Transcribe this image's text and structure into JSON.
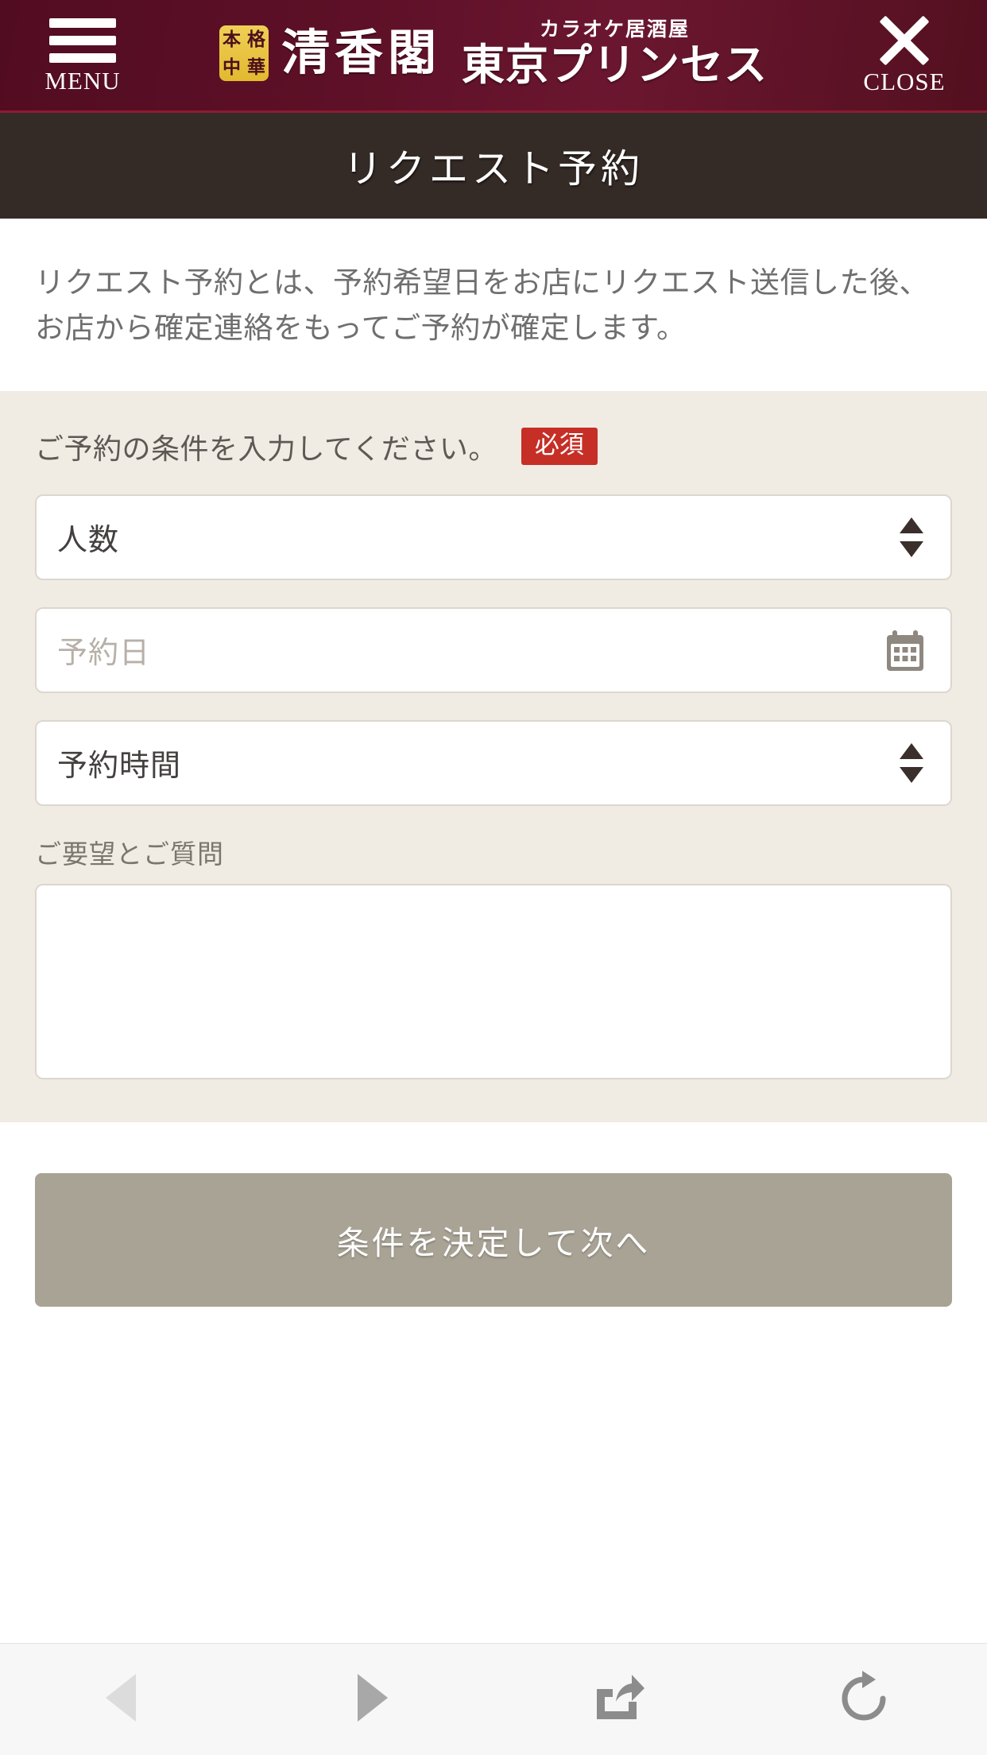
{
  "header": {
    "menu_label": "MENU",
    "close_label": "CLOSE",
    "badge_chars": [
      "本",
      "格",
      "中",
      "華"
    ],
    "shop_name": "清香閣",
    "sub_name": "カラオケ居酒屋",
    "main_name": "東京プリンセス",
    "bg_color": "#5d1027",
    "accent_line_color": "#8e1b33",
    "badge_color": "#e2b92f"
  },
  "page_title": "リクエスト予約",
  "title_band_color": "#342a26",
  "intro": {
    "text": "リクエスト予約とは、予約希望日をお店にリクエスト送信した後、お店から確定連絡をもってご予約が確定します。"
  },
  "form": {
    "heading": "ご予約の条件を入力してください。",
    "required_badge": "必須",
    "required_badge_color": "#c62f26",
    "panel_bg": "#f0ece4",
    "fields": [
      {
        "name": "party-size",
        "value": "人数",
        "is_placeholder": false,
        "icon": "stepper-icon"
      },
      {
        "name": "reservation-date",
        "value": "予約日",
        "is_placeholder": true,
        "icon": "calendar-icon"
      },
      {
        "name": "reservation-time",
        "value": "予約時間",
        "is_placeholder": false,
        "icon": "stepper-icon"
      }
    ],
    "textarea_label": "ご要望とご質問",
    "textarea_value": ""
  },
  "submit": {
    "label": "条件を決定して次へ",
    "color": "#a9a396"
  },
  "browser_toolbar": {
    "buttons": [
      {
        "name": "back-button",
        "icon": "triangle-left-icon",
        "enabled": false
      },
      {
        "name": "forward-button",
        "icon": "triangle-right-icon",
        "enabled": true
      },
      {
        "name": "share-button",
        "icon": "share-icon",
        "enabled": true
      },
      {
        "name": "reload-button",
        "icon": "reload-icon",
        "enabled": true
      }
    ]
  }
}
